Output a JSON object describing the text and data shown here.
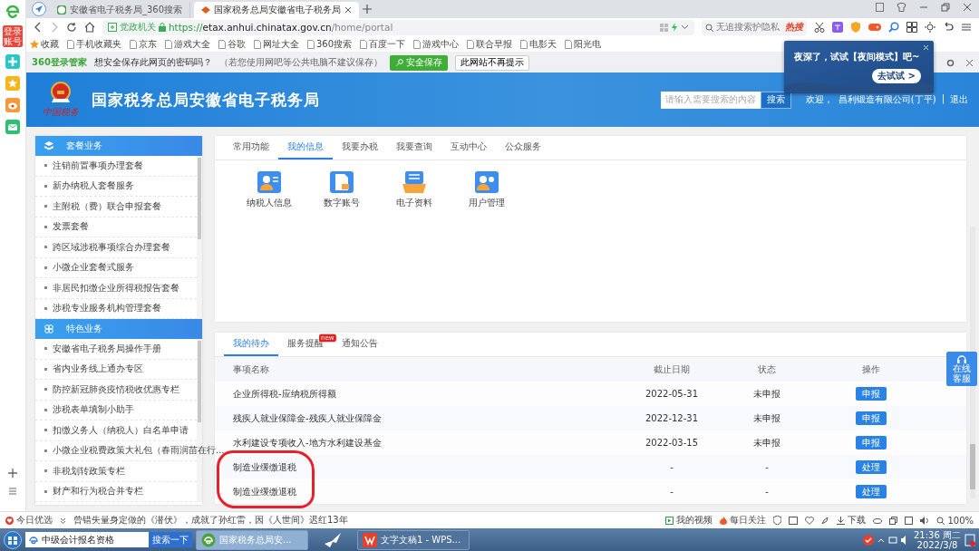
{
  "app_sidebar": {
    "badge": "登录账号"
  },
  "browser": {
    "tabs": [
      {
        "label": "安徽省电子税务局_360搜索",
        "selected": false
      },
      {
        "label": "国家税务总局安徽省电子税务局",
        "selected": true
      }
    ],
    "address": {
      "badge": "党政机关",
      "scheme": "https://",
      "host": "etax.anhui.chinatax.gov.cn",
      "path": "/home/portal"
    },
    "search": {
      "placeholder": "无追搜索护隐私",
      "hot": "热搜"
    },
    "bookmarks": [
      "收藏",
      "手机收藏夹",
      "京东",
      "游戏大全",
      "谷歌",
      "网址大全",
      "360搜索",
      "百度一下",
      "游戏中心",
      "联合早报",
      "电影天",
      "阳光电"
    ],
    "password_bar": {
      "brand": "360登录管家",
      "question": "想安全保存此网页的密码吗？",
      "hint": "（若您使用网吧等公共电脑不建议保存）",
      "save": "安全保存",
      "dismiss": "此网站不再提示"
    }
  },
  "popup": {
    "message": "夜深了，试试【夜间模式】吧~",
    "button": "去试试 >"
  },
  "header": {
    "logo_text": "中国税务",
    "title": "国家税务总局安徽省电子税务局",
    "search_placeholder": "请输入需要搜索的内容",
    "search_button": "搜索",
    "welcome": "欢迎，",
    "user": "昌利锻造有限公司(丁平)",
    "separator": "|",
    "logout": "退出"
  },
  "sidebar": {
    "sections": [
      {
        "title": "套餐业务",
        "items": [
          "注销前置事项办理套餐",
          "新办纳税人套餐服务",
          "主附税（费）联合申报套餐",
          "发票套餐",
          "跨区域涉税事项综合办理套餐",
          "小微企业套餐式服务",
          "非居民扣缴企业所得税报告套餐",
          "涉税专业服务机构管理套餐"
        ]
      },
      {
        "title": "特色业务",
        "items": [
          "安徽省电子税务局操作手册",
          "省内业务线上通办专区",
          "防控新冠肺炎疫情税收优惠专栏",
          "涉税表单填制小助手",
          "扣缴义务人（纳税人）白名单申请",
          "小微企业税费政策大礼包（春雨润苗在行...",
          "非税划转政策专栏",
          "财产和行为税合并专栏"
        ]
      }
    ]
  },
  "info_panel": {
    "tabs": [
      {
        "label": "常用功能",
        "selected": false
      },
      {
        "label": "我的信息",
        "selected": true
      },
      {
        "label": "我要办税",
        "selected": false
      },
      {
        "label": "我要查询",
        "selected": false
      },
      {
        "label": "互动中心",
        "selected": false
      },
      {
        "label": "公众服务",
        "selected": false
      }
    ],
    "shortcuts": [
      {
        "label": "纳税人信息",
        "kind": "person"
      },
      {
        "label": "数字账号",
        "kind": "document"
      },
      {
        "label": "电子资料",
        "kind": "tray"
      },
      {
        "label": "用户管理",
        "kind": "users"
      }
    ]
  },
  "todo_panel": {
    "tabs": [
      {
        "label": "我的待办",
        "selected": true
      },
      {
        "label": "服务提醒",
        "selected": false,
        "badge": "new"
      },
      {
        "label": "通知公告",
        "selected": false
      }
    ],
    "columns": [
      "事项名称",
      "截止日期",
      "状态",
      "操作"
    ],
    "rows": [
      {
        "name": "企业所得税-应纳税所得额",
        "deadline": "2022-05-31",
        "status": "未申报",
        "action": "申报",
        "circled": false
      },
      {
        "name": "残疾人就业保障金-残疾人就业保障金",
        "deadline": "2022-12-31",
        "status": "未申报",
        "action": "申报",
        "circled": false
      },
      {
        "name": "水利建设专项收入-地方水利建设基金",
        "deadline": "2022-03-15",
        "status": "未申报",
        "action": "申报",
        "circled": false
      },
      {
        "name": "制造业缓缴退税",
        "deadline": "-",
        "status": "-",
        "action": "处理",
        "circled": true
      },
      {
        "name": "制造业缓缴退税",
        "deadline": "-",
        "status": "-",
        "action": "处理",
        "circled": true
      }
    ]
  },
  "help_button": "在线客服",
  "status_bar": {
    "today": "今日优选",
    "news": "曾错失量身定做的《潜伏》，成就了孙红雷，因《人世间》迟红13年",
    "video": "我的视频",
    "follow": "每日关注",
    "download": "下载",
    "zoom": "100%"
  },
  "taskbar": {
    "search_value": "中级会计报名资格",
    "search_button": "搜索一下",
    "tasks": [
      {
        "label": "国家税务总局安...",
        "selected": true
      },
      {
        "label": "文字文稿1 - WPS...",
        "selected": false
      }
    ],
    "time": "21:36 周二",
    "date": "2022/3/8"
  }
}
